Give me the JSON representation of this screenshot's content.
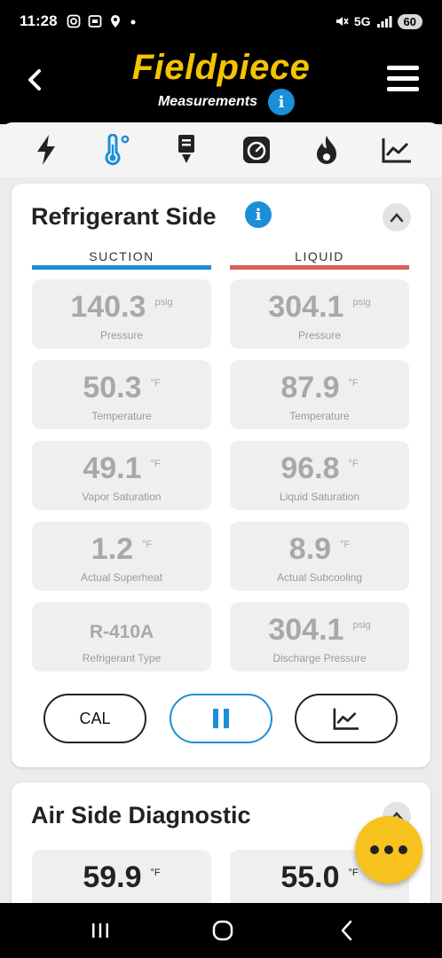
{
  "status_bar": {
    "time": "11:28",
    "network": "5G",
    "battery": "60"
  },
  "header": {
    "logo": "Fieldpiece",
    "subtitle": "Measurements",
    "info_glyph": "i"
  },
  "tabs": [
    {
      "icon": "lightning-icon"
    },
    {
      "icon": "thermometer-icon",
      "active": true
    },
    {
      "icon": "charging-icon"
    },
    {
      "icon": "gauge-icon"
    },
    {
      "icon": "flame-icon"
    },
    {
      "icon": "chart-icon"
    }
  ],
  "refrigerant": {
    "title": "Refrigerant Side",
    "suction_label": "SUCTION",
    "liquid_label": "LIQUID",
    "colors": {
      "suction": "#1b8fd8",
      "liquid": "#d9605a"
    },
    "suction": [
      {
        "value": "140.3",
        "unit": "psig",
        "label": "Pressure"
      },
      {
        "value": "50.3",
        "unit": "°F",
        "label": "Temperature"
      },
      {
        "value": "49.1",
        "unit": "°F",
        "label": "Vapor Saturation"
      },
      {
        "value": "1.2",
        "unit": "°F",
        "label": "Actual Superheat"
      },
      {
        "value": "R-410A",
        "unit": "",
        "label": "Refrigerant Type"
      }
    ],
    "liquid": [
      {
        "value": "304.1",
        "unit": "psig",
        "label": "Pressure"
      },
      {
        "value": "87.9",
        "unit": "°F",
        "label": "Temperature"
      },
      {
        "value": "96.8",
        "unit": "°F",
        "label": "Liquid Saturation"
      },
      {
        "value": "8.9",
        "unit": "°F",
        "label": "Actual Subcooling"
      },
      {
        "value": "304.1",
        "unit": "psig",
        "label": "Discharge Pressure"
      }
    ],
    "buttons": {
      "cal": "CAL"
    }
  },
  "air_side": {
    "title": "Air Side Diagnostic",
    "tiles": [
      {
        "value": "59.9",
        "unit": "°F"
      },
      {
        "value": "55.0",
        "unit": "°F"
      }
    ]
  }
}
